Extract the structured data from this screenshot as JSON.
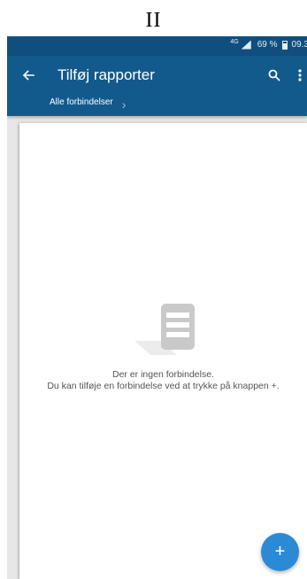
{
  "caption": "II",
  "status_bar": {
    "network": "4G",
    "battery": "69 %",
    "time": "09.3"
  },
  "app_bar": {
    "back_icon": "arrow-left-icon",
    "title": "Tilføj rapporter",
    "search_icon": "search-icon",
    "more_icon": "more-vertical-icon",
    "breadcrumb": "Alle forbindelser",
    "breadcrumb_icon": "chevron-right-icon"
  },
  "empty_state": {
    "icon": "server-icon",
    "line1": "Der er ingen forbindelse.",
    "line2": "Du kan tilføje en forbindelse ved at trykke på knappen +."
  },
  "fab": {
    "label": "+",
    "icon": "plus-icon"
  },
  "colors": {
    "status_bar": "#104f7d",
    "app_bar": "#135a8c",
    "fab": "#2b8ad6",
    "background": "#e7e7e7",
    "card": "#ffffff"
  }
}
